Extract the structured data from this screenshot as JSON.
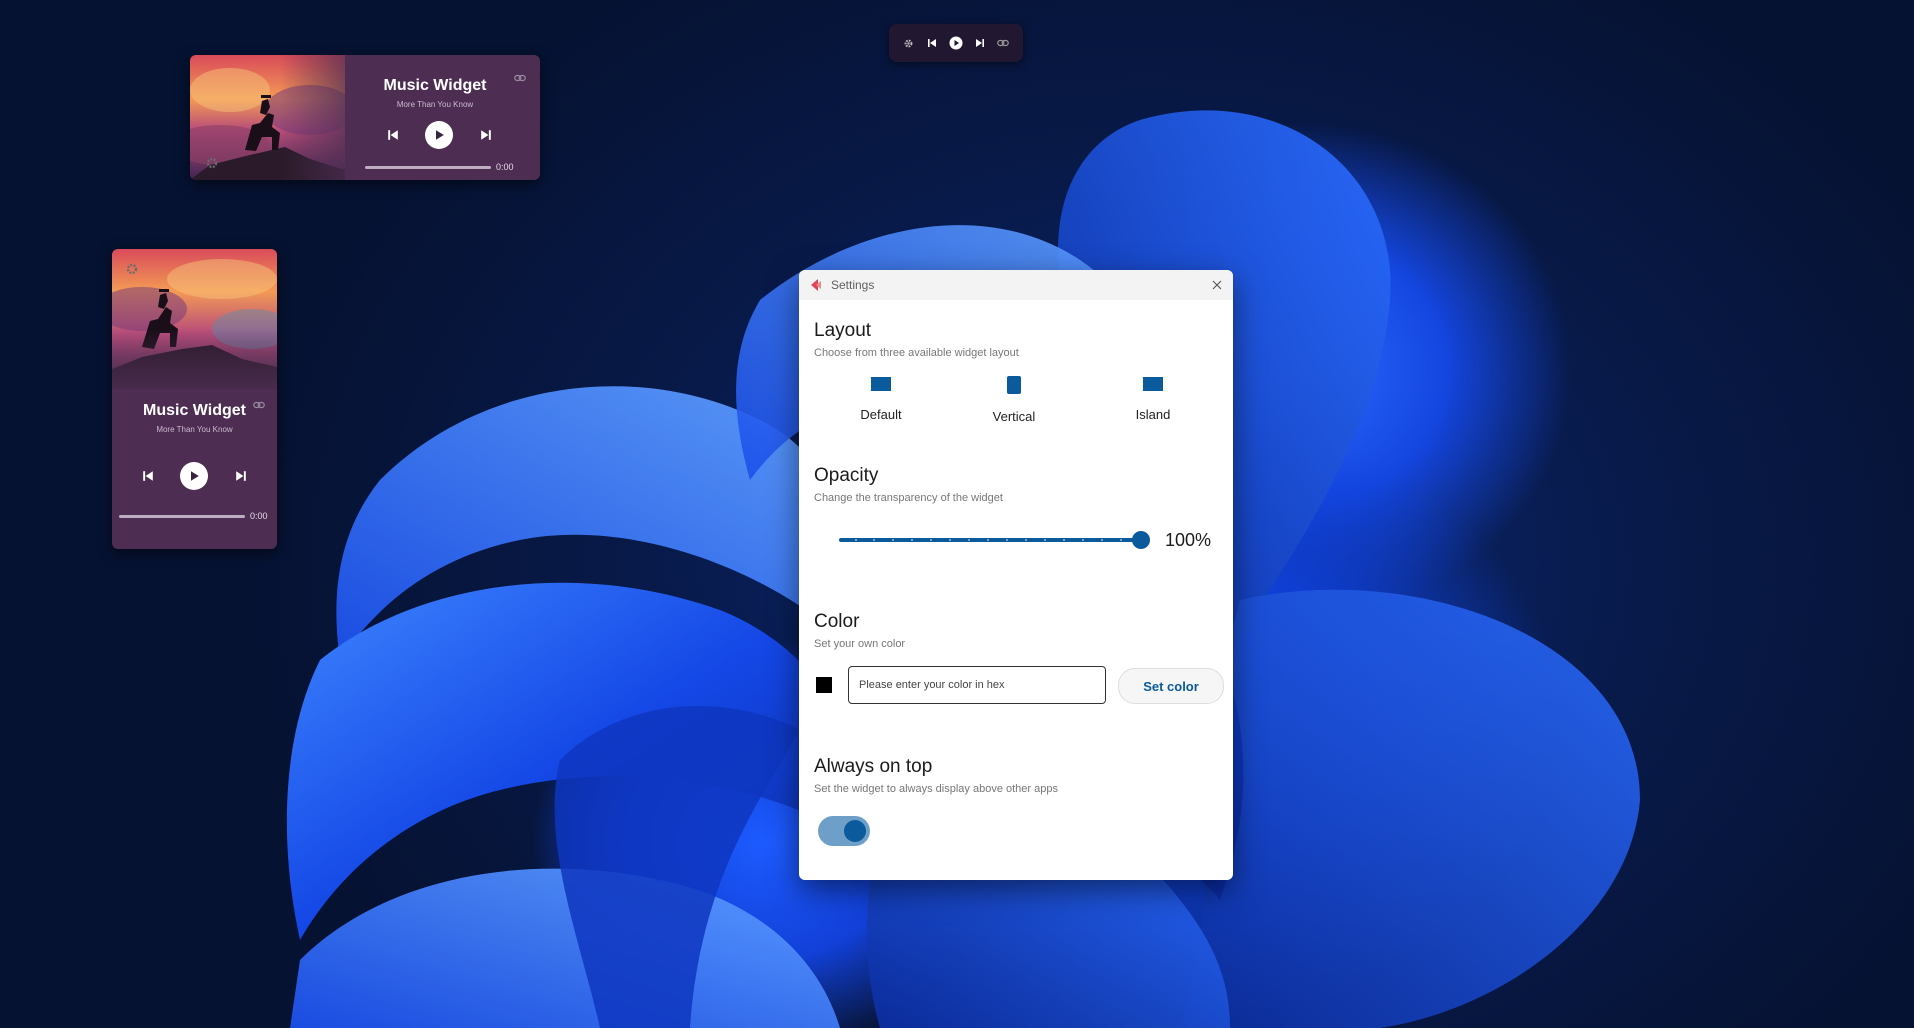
{
  "island": {
    "buttons": [
      "gear-icon",
      "previous-icon",
      "play-icon",
      "next-icon",
      "link-icon"
    ]
  },
  "widget_default": {
    "title": "Music Widget",
    "subtitle": "More Than You Know",
    "time": "0:00",
    "progress": 0
  },
  "widget_vertical": {
    "title": "Music Widget",
    "subtitle": "More Than You Know",
    "time": "0:00",
    "progress": 0
  },
  "settings": {
    "window_title": "Settings",
    "layout": {
      "title": "Layout",
      "desc": "Choose from three available widget layout",
      "options": [
        {
          "label": "Default"
        },
        {
          "label": "Vertical"
        },
        {
          "label": "Island"
        }
      ]
    },
    "opacity": {
      "title": "Opacity",
      "desc": "Change the transparency of the widget",
      "value": 100,
      "value_label": "100%"
    },
    "color": {
      "title": "Color",
      "desc": "Set your own color",
      "current": "#000000",
      "input_value": "",
      "placeholder": "Please enter your color in hex",
      "button": "Set color"
    },
    "always_on_top": {
      "title": "Always on top",
      "desc": "Set the widget to always display above other apps",
      "enabled": true
    }
  },
  "colors": {
    "accent": "#0a5a9c",
    "widget_bg": "#4d2e52"
  }
}
